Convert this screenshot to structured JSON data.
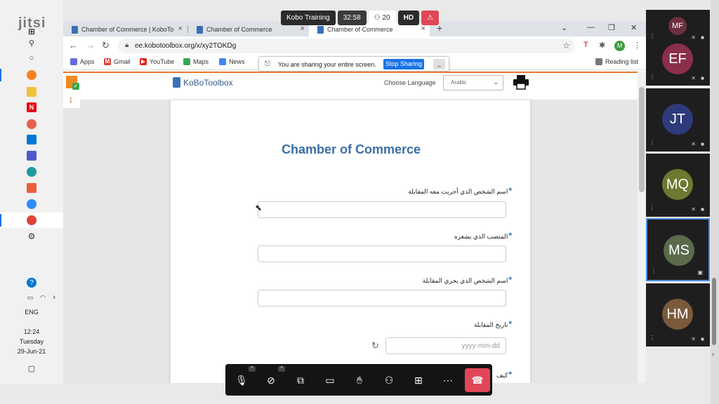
{
  "jitsi": {
    "logo": "jitsi",
    "meeting_title": "Kobo Training",
    "timer": "32:58",
    "participant_count": "20",
    "hd_label": "HD"
  },
  "taskbar": {
    "system": {
      "language": "ENG",
      "time": "12:24",
      "day": "Tuesday",
      "date": "29-Jun-21"
    }
  },
  "browser": {
    "tabs": [
      {
        "label": "Chamber of Commerce | KoboTo"
      },
      {
        "label": "Chamber of Commerce"
      },
      {
        "label": "Chamber of Commerce"
      }
    ],
    "url": "ee.kobotoolbox.org/x/xy2TOKDg",
    "profile_initial": "M",
    "bookmarks": [
      {
        "label": "Apps"
      },
      {
        "label": "Gmail"
      },
      {
        "label": "YouTube"
      },
      {
        "label": "Maps"
      },
      {
        "label": "News"
      }
    ],
    "reading_list": "Reading list"
  },
  "share_bar": {
    "message": "You are sharing your entire screen.",
    "stop_label": "Stop Sharing"
  },
  "kobo": {
    "logo_text": "KoBoToolbox",
    "side_number": "1",
    "choose_language_label": "Choose Language",
    "language_value": "Arabic",
    "form_title": "Chamber of Commerce",
    "questions": [
      {
        "label": "اسم الشخص الذي أجريت معه المقابلة",
        "required": "*"
      },
      {
        "label": "المنصب الذي يشغره",
        "required": "*"
      },
      {
        "label": "اسم الشخص الذي يجري المقابلة",
        "required": "*"
      },
      {
        "label": "تاريخ المقابلة",
        "required": "*"
      },
      {
        "label": "كيف",
        "required": "*"
      }
    ],
    "date_placeholder": "yyyy-mm-dd"
  },
  "participants": [
    {
      "initials": "MF",
      "color": "#6b2f3e"
    },
    {
      "initials": "EF",
      "color": "#8a2f4a"
    },
    {
      "initials": "JT",
      "color": "#2f3a7a"
    },
    {
      "initials": "MQ",
      "color": "#6b7a2f"
    },
    {
      "initials": "MS",
      "color": "#5a6a4a"
    },
    {
      "initials": "HM",
      "color": "#7a5a3a"
    }
  ]
}
